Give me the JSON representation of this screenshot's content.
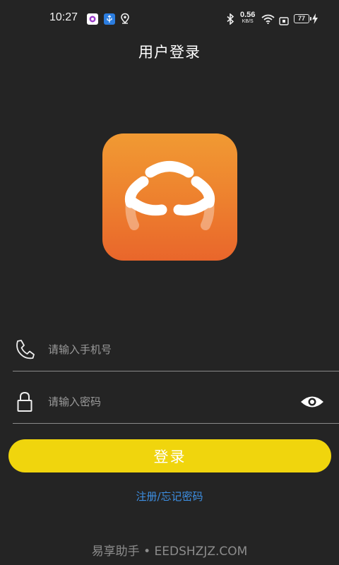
{
  "status_bar": {
    "time": "10:27",
    "icons": [
      "app-notification-icon",
      "usb-icon",
      "location-icon",
      "bluetooth-icon",
      "wifi-icon",
      "nfc-icon",
      "charging-icon"
    ],
    "net_speed_value": "0.56",
    "net_speed_unit": "KB/S",
    "battery_level": "77"
  },
  "header": {
    "title": "用户登录"
  },
  "form": {
    "phone_placeholder": "请输入手机号",
    "password_placeholder": "请输入密码",
    "login_label": "登录",
    "register_forgot_label": "注册/忘记密码"
  },
  "watermark": "易享助手 • EEDSHZJZ.COM",
  "colors": {
    "background": "#242424",
    "accent_button": "#f0d50d",
    "link": "#3d8fe3",
    "logo_gradient_top": "#f19a33",
    "logo_gradient_bottom": "#e9662b"
  }
}
